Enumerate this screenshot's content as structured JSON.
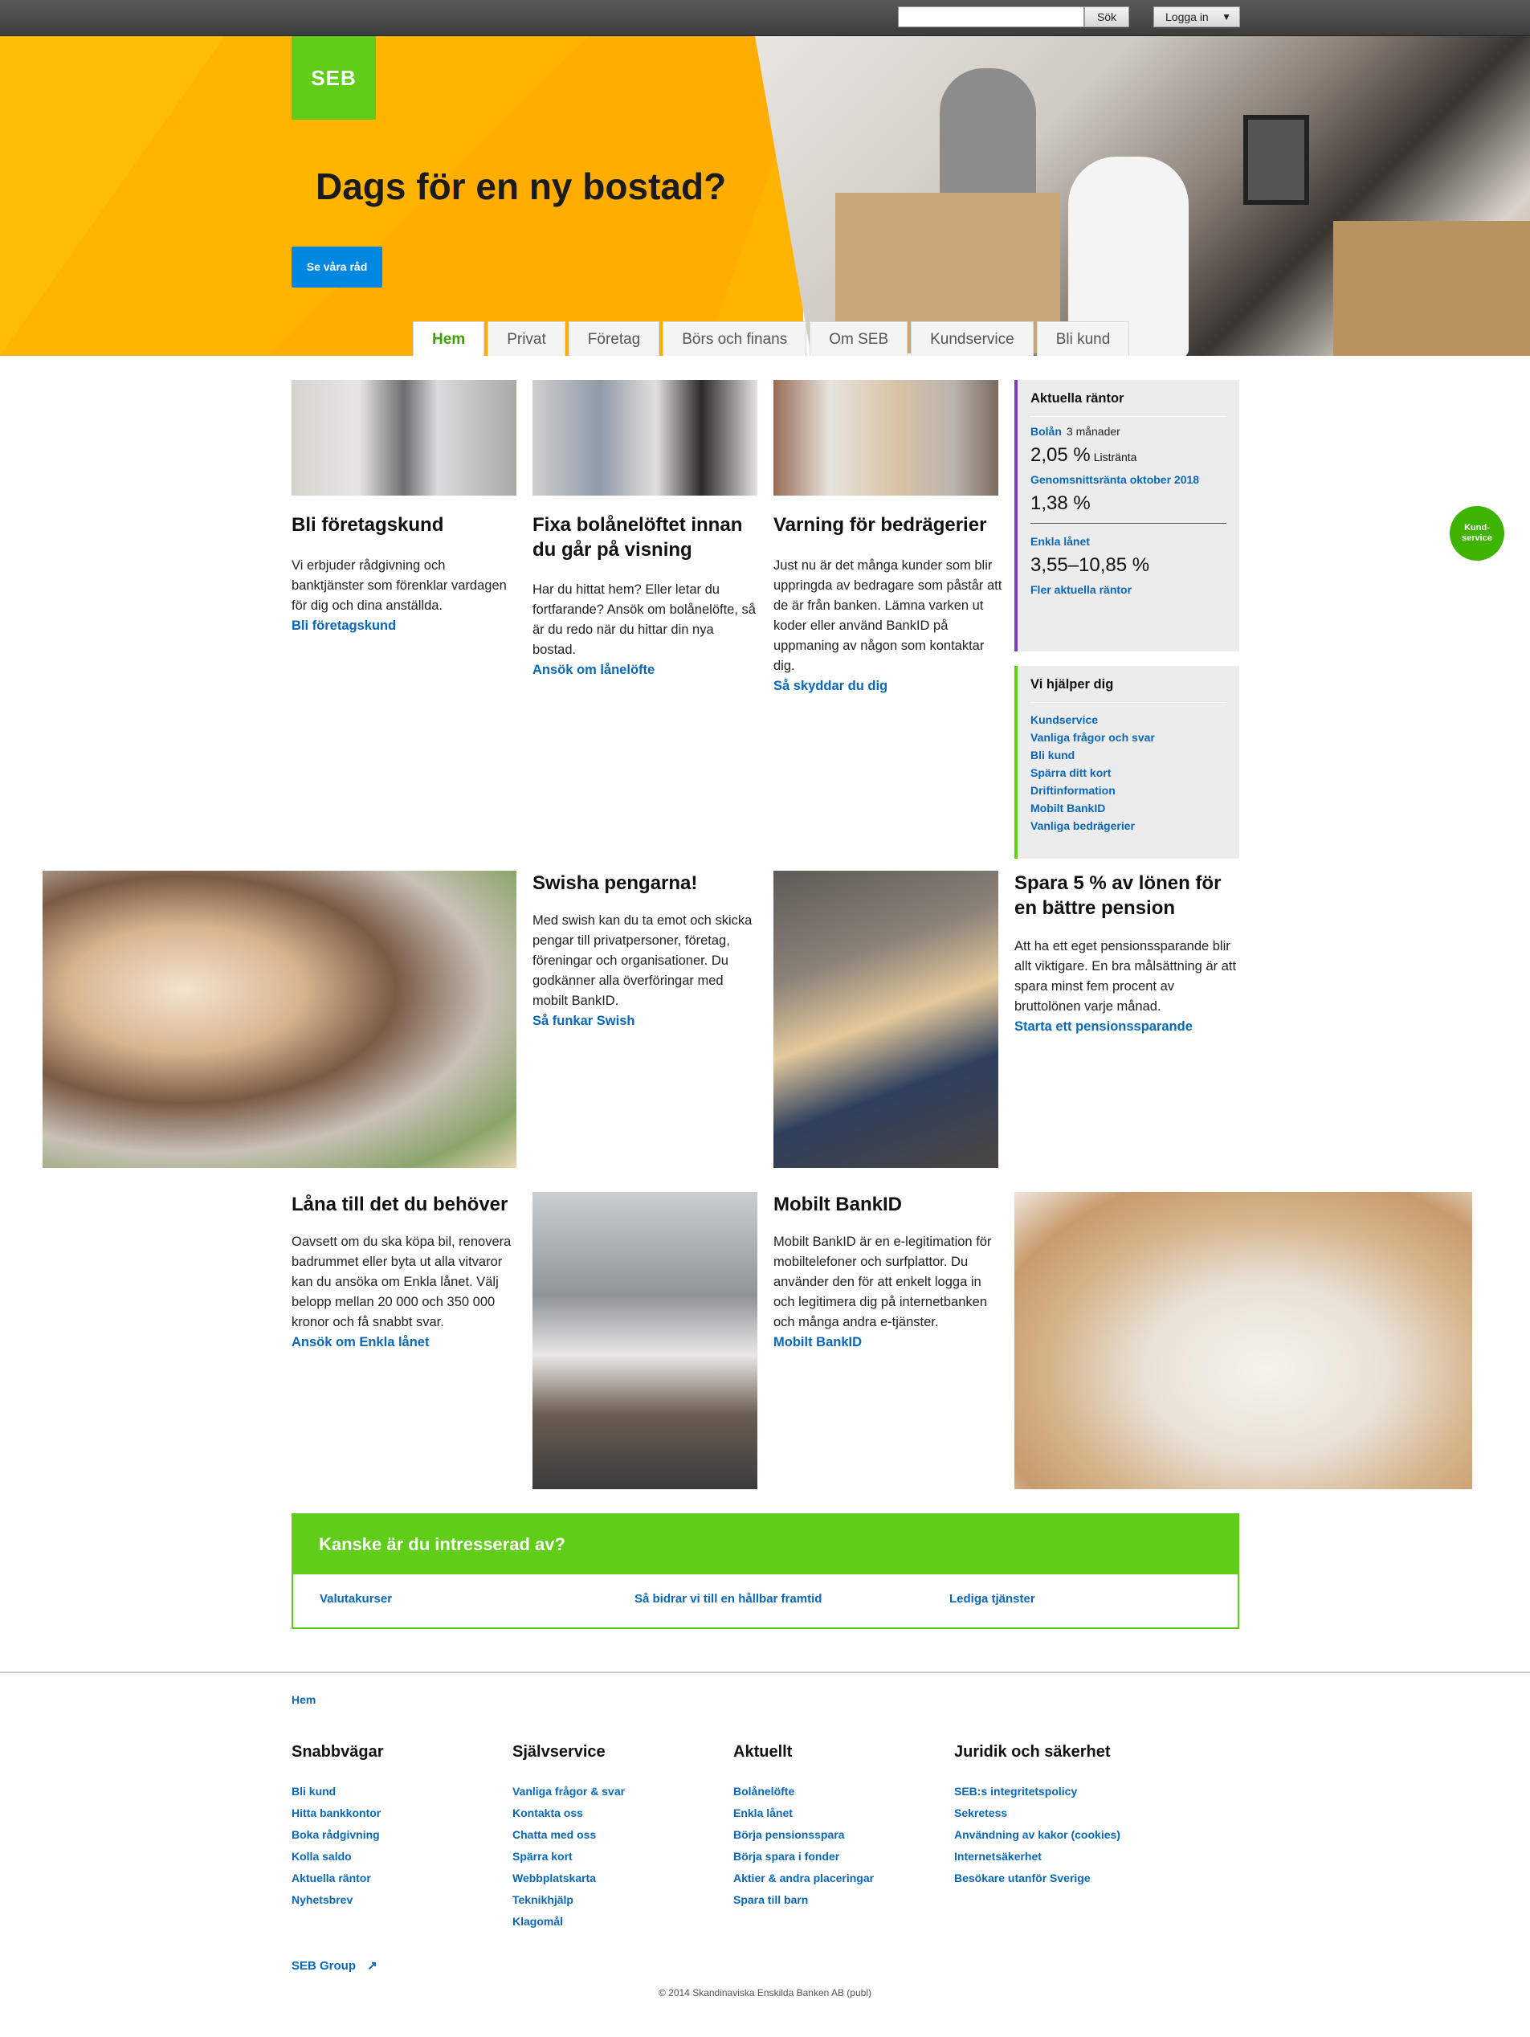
{
  "topbar": {
    "search_button": "Sök",
    "login_button": "Logga in"
  },
  "hero": {
    "logo": "SEB",
    "title": "Dags för en ny bostad?",
    "cta": "Se våra råd"
  },
  "tabs": [
    "Hem",
    "Privat",
    "Företag",
    "Börs och finans",
    "Om SEB",
    "Kundservice",
    "Bli kund"
  ],
  "cards": [
    {
      "title": "Bli företagskund",
      "text": "Vi erbjuder rådgivning och banktjänster som förenklar vardagen för dig och dina anställda.",
      "link": "Bli företagskund"
    },
    {
      "title": "Fixa bolånelöftet innan du går på visning",
      "text": "Har du hittat hem? Eller letar du fortfarande? Ansök om bolånelöfte, så är du redo när du hittar din nya bostad.",
      "link": "Ansök om lånelöfte"
    },
    {
      "title": "Varning för bedrägerier",
      "text": "Just nu är det många kunder som blir uppringda av bedragare som påstår att de är från banken. Lämna varken ut koder eller använd BankID på uppmaning av någon som kontaktar dig.",
      "link": "Så skyddar du dig"
    },
    {
      "title": "Swisha pengarna!",
      "text": "Med swish kan du ta emot och skicka pengar till privatpersoner, företag, föreningar och organisationer. Du godkänner alla överföringar med mobilt BankID.",
      "link": "Så funkar Swish"
    },
    {
      "title": "Spara 5 % av lönen för en bättre pension",
      "text": "Att ha ett eget pensionssparande blir allt viktigare. En bra målsättning är att spara minst fem procent av bruttolönen varje månad.",
      "link": "Starta ett pensionssparande"
    },
    {
      "title": "Låna till det du behöver",
      "text": "Oavsett om du ska köpa bil, renovera badrummet eller byta ut alla vitvaror kan du ansöka om Enkla lånet. Välj belopp mellan 20 000 och 350 000 kronor och få snabbt svar.",
      "link": "Ansök om Enkla lånet"
    },
    {
      "title": "Mobilt BankID",
      "text": "Mobilt BankID är en e-legitimation för mobiltelefoner och surfplattor. Du använder den för att enkelt logga in och legitimera dig på internetbanken och många andra e-tjänster.",
      "link": "Mobilt BankID"
    }
  ],
  "rates": {
    "heading": "Aktuella räntor",
    "bolan_label": "Bolån",
    "bolan_term": "3 månader",
    "bolan_value": "2,05 %",
    "bolan_unit": "Listränta",
    "avg_label": "Genomsnittsränta oktober 2018",
    "avg_value": "1,38 %",
    "enkla_label": "Enkla lånet",
    "enkla_value": "3,55–10,85 %",
    "more_link": "Fler aktuella räntor",
    "accent": "#7a3fb8"
  },
  "help": {
    "heading": "Vi hjälper dig",
    "links": [
      "Kundservice",
      "Vanliga frågor och svar",
      "Bli kund",
      "Spärra ditt kort",
      "Driftinformation",
      "Mobilt BankID",
      "Vanliga bedrägerier"
    ],
    "accent": "#60cd18"
  },
  "kundservice_bubble": "Kund-service",
  "interest": {
    "heading": "Kanske är du intresserad av?",
    "links": [
      "Valutakurser",
      "Så bidrar vi till en hållbar framtid",
      "Lediga tjänster"
    ]
  },
  "footer": {
    "breadcrumb": "Hem",
    "columns": [
      {
        "title": "Snabbvägar",
        "links": [
          "Bli kund",
          "Hitta bankkontor",
          "Boka rådgivning",
          "Kolla saldo",
          "Aktuella räntor",
          "Nyhetsbrev"
        ]
      },
      {
        "title": "Självservice",
        "links": [
          "Vanliga frågor & svar",
          "Kontakta oss",
          "Chatta med oss",
          "Spärra kort",
          "Webbplatskarta",
          "Teknikhjälp",
          "Klagomål"
        ]
      },
      {
        "title": "Aktuellt",
        "links": [
          "Bolånelöfte",
          "Enkla lånet",
          "Börja pensionsspara",
          "Börja spara i fonder",
          "Aktier & andra placeringar",
          "Spara till barn"
        ]
      },
      {
        "title": "Juridik och säkerhet",
        "links": [
          "SEB:s integritetspolicy",
          "Sekretess",
          "Användning av kakor (cookies)",
          "Internetsäkerhet",
          "Besökare utanför Sverige"
        ]
      }
    ],
    "group_link": "SEB Group",
    "copyright": "© 2014 Skandinaviska Enskilda Banken AB (publ)"
  },
  "colors": {
    "brand_green": "#60cd18",
    "hero_yellow": "#ffb400",
    "link_blue": "#0a67b8",
    "cta_blue": "#0088e0"
  }
}
